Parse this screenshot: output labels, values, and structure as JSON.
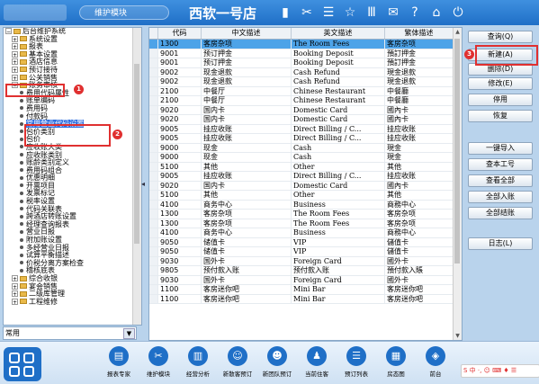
{
  "topbar": {
    "search_label": "维护模块",
    "hotel_name": "西软一号店",
    "icons": [
      "signal-icon",
      "tools-icon",
      "list-icon",
      "star-icon",
      "columns-icon",
      "mail-icon",
      "help-icon",
      "home-icon",
      "power-icon"
    ]
  },
  "tree": {
    "items": [
      {
        "label": "后台维护系统",
        "level": 0,
        "type": "folder",
        "expanded": true
      },
      {
        "label": "系统设置",
        "level": 1,
        "type": "folder-closed"
      },
      {
        "label": "报表",
        "level": 1,
        "type": "folder-closed"
      },
      {
        "label": "基本设置",
        "level": 1,
        "type": "folder-closed"
      },
      {
        "label": "酒店信息",
        "level": 1,
        "type": "folder-closed"
      },
      {
        "label": "预订接待",
        "level": 1,
        "type": "folder-closed"
      },
      {
        "label": "公关销售",
        "level": 1,
        "type": "folder-closed"
      },
      {
        "label": "账务审核",
        "level": 1,
        "type": "folder",
        "expanded": true
      },
      {
        "label": "费用代码属性",
        "level": 2,
        "type": "dot"
      },
      {
        "label": "账单编码",
        "level": 2,
        "type": "dot"
      },
      {
        "label": "费用码",
        "level": 2,
        "type": "dot"
      },
      {
        "label": "付款码",
        "level": 2,
        "type": "dot"
      },
      {
        "label": "常用营业代码设置",
        "level": 2,
        "type": "dot",
        "selected": true
      },
      {
        "label": "包价类别",
        "level": 2,
        "type": "dot"
      },
      {
        "label": "包价",
        "level": 2,
        "type": "dot"
      },
      {
        "label": "应收账大类",
        "level": 2,
        "type": "dot"
      },
      {
        "label": "应收账类别",
        "level": 2,
        "type": "dot"
      },
      {
        "label": "账龄类别定义",
        "level": 2,
        "type": "dot"
      },
      {
        "label": "费用码组合",
        "level": 2,
        "type": "dot"
      },
      {
        "label": "优惠明细",
        "level": 2,
        "type": "dot"
      },
      {
        "label": "开票项目",
        "level": 2,
        "type": "dot"
      },
      {
        "label": "发票标记",
        "level": 2,
        "type": "dot"
      },
      {
        "label": "税率设置",
        "level": 2,
        "type": "dot"
      },
      {
        "label": "代码关联表",
        "level": 2,
        "type": "dot"
      },
      {
        "label": "跨酒店转账设置",
        "level": 2,
        "type": "dot"
      },
      {
        "label": "经理查询报表",
        "level": 2,
        "type": "dot"
      },
      {
        "label": "营业日报",
        "level": 2,
        "type": "dot"
      },
      {
        "label": "附加账设置",
        "level": 2,
        "type": "dot"
      },
      {
        "label": "多经营业日报",
        "level": 2,
        "type": "dot"
      },
      {
        "label": "试算平衡描述",
        "level": 2,
        "type": "dot"
      },
      {
        "label": "价税分离方案检查",
        "level": 2,
        "type": "dot"
      },
      {
        "label": "稽核底表",
        "level": 2,
        "type": "dot"
      },
      {
        "label": "综合收银",
        "level": 1,
        "type": "folder-closed"
      },
      {
        "label": "宴会销售",
        "level": 1,
        "type": "folder-closed"
      },
      {
        "label": "二级库管理",
        "level": 1,
        "type": "folder-closed"
      },
      {
        "label": "工程维修",
        "level": 1,
        "type": "folder-closed"
      }
    ],
    "badge_1": "1",
    "badge_2": "2",
    "badge_3": "3"
  },
  "filter": {
    "value": "常用",
    "arrow": "▼"
  },
  "grid": {
    "headers": [
      "代码",
      "中文描述",
      "英文描述",
      "繁体描述"
    ],
    "rows": [
      [
        "1300",
        "客房杂项",
        "The Room Fees",
        "客房杂项"
      ],
      [
        "9001",
        "预订押金",
        "Booking Deposit",
        "預訂押金"
      ],
      [
        "9001",
        "预订押金",
        "Booking Deposit",
        "預訂押金"
      ],
      [
        "9002",
        "现金退款",
        "Cash Refund",
        "現金退款"
      ],
      [
        "9002",
        "现金退款",
        "Cash Refund",
        "現金退款"
      ],
      [
        "2100",
        "中餐厅",
        "Chinese Restaurant",
        "中餐廳"
      ],
      [
        "2100",
        "中餐厅",
        "Chinese Restaurant",
        "中餐廳"
      ],
      [
        "9020",
        "国内卡",
        "Domestic Card",
        "國內卡"
      ],
      [
        "9020",
        "国内卡",
        "Domestic Card",
        "國內卡"
      ],
      [
        "9005",
        "挂应收账",
        "Direct Billing / C...",
        "挂应收账"
      ],
      [
        "9005",
        "挂应收账",
        "Direct Billing / C...",
        "挂应收账"
      ],
      [
        "9000",
        "现金",
        "Cash",
        "現金"
      ],
      [
        "9000",
        "现金",
        "Cash",
        "現金"
      ],
      [
        "5100",
        "其他",
        "Other",
        "其他"
      ],
      [
        "9005",
        "挂应收账",
        "Direct Billing / C...",
        "挂应收账"
      ],
      [
        "9020",
        "国内卡",
        "Domestic Card",
        "國內卡"
      ],
      [
        "5100",
        "其他",
        "Other",
        "其他"
      ],
      [
        "4100",
        "商务中心",
        "Business",
        "商務中心"
      ],
      [
        "1300",
        "客房杂项",
        "The Room Fees",
        "客房杂项"
      ],
      [
        "1300",
        "客房杂项",
        "The Room Fees",
        "客房杂项"
      ],
      [
        "4100",
        "商务中心",
        "Business",
        "商務中心"
      ],
      [
        "9050",
        "储值卡",
        "VIP",
        "儲值卡"
      ],
      [
        "9050",
        "储值卡",
        "VIP",
        "儲值卡"
      ],
      [
        "9030",
        "国外卡",
        "Foreign Card",
        "國外卡"
      ],
      [
        "9805",
        "预付款入账",
        "预付款入账",
        "預付款入賬"
      ],
      [
        "9030",
        "国外卡",
        "Foreign Card",
        "國外卡"
      ],
      [
        "1100",
        "客房迷你吧",
        "Mini Bar",
        "客房迷你吧"
      ],
      [
        "1100",
        "客房迷你吧",
        "Mini Bar",
        "客房迷你吧"
      ]
    ]
  },
  "buttons": [
    "查询(Q)",
    "新建(A)",
    "删除(D)",
    "修改(E)",
    "停用",
    "恢复",
    "一键导入",
    "查本工号",
    "查看全部",
    "全部入账",
    "全部结账",
    "日志(L)"
  ],
  "bottom": {
    "items": [
      "报表专家",
      "维护模块",
      "经营分析",
      "新散客预订",
      "新团队预订",
      "当前住客",
      "预订列表",
      "房态图",
      "前台"
    ],
    "tray_text": "S 中 ·, ☺ ⌨ ♦ ☰"
  },
  "colors": {
    "accent": "#1f6fc7",
    "selected_row": "#4da3e8",
    "highlight": "#e03030"
  }
}
